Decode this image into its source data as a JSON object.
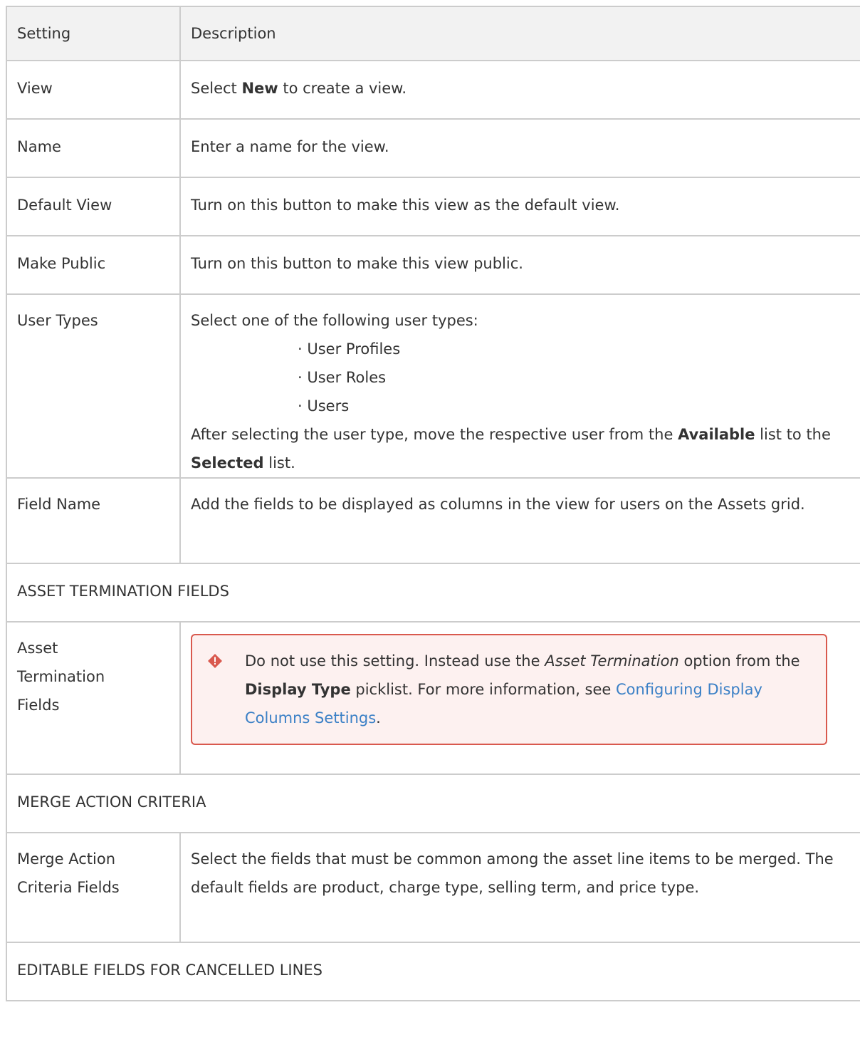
{
  "header": {
    "setting": "Setting",
    "description": "Description"
  },
  "rows": {
    "view": {
      "setting": "View",
      "pre": "Select ",
      "bold": "New",
      "post": " to create a view."
    },
    "name": {
      "setting": "Name",
      "desc": "Enter a name for the view."
    },
    "default_view": {
      "setting": "Default View",
      "desc": "Turn on this button to make this view as the default view."
    },
    "make_public": {
      "setting": "Make Public",
      "desc": "Turn on this button to make this view public."
    },
    "user_types": {
      "setting": "User Types",
      "intro": "Select one of the following user types:",
      "items": [
        "User Profiles",
        "User Roles",
        "Users"
      ],
      "after_pre": "After selecting the user type, move the respective user from the ",
      "available": "Available",
      "mid": " list to the ",
      "selected": "Selected",
      "end": " list."
    },
    "field_name": {
      "setting": "Field Name",
      "desc": "Add the fields to be displayed as columns in the view for users on the Assets grid."
    },
    "asset_termination": {
      "setting": "Asset Termination Fields",
      "warn_pre": "Do not use this setting. Instead use the ",
      "warn_italic": "Asset Termination",
      "warn_mid": " option from the ",
      "warn_bold": "Display Type",
      "warn_post": " picklist. For more information, see ",
      "warn_link": "Configuring Display Columns Settings",
      "warn_end": "."
    },
    "merge_action": {
      "setting": "Merge Action Criteria Fields",
      "desc": "Select the fields that must be common among the asset line items to be merged. The default fields are product, charge type, selling term, and price type."
    }
  },
  "sections": {
    "asset_termination": "ASSET TERMINATION FIELDS",
    "merge_action": "MERGE ACTION CRITERIA",
    "editable_cancelled": "EDITABLE FIELDS FOR CANCELLED LINES"
  },
  "colors": {
    "warning_border": "#d9594e",
    "warning_bg": "#fdf1f0",
    "link": "#3b80c6",
    "header_bg": "#f2f2f2"
  }
}
